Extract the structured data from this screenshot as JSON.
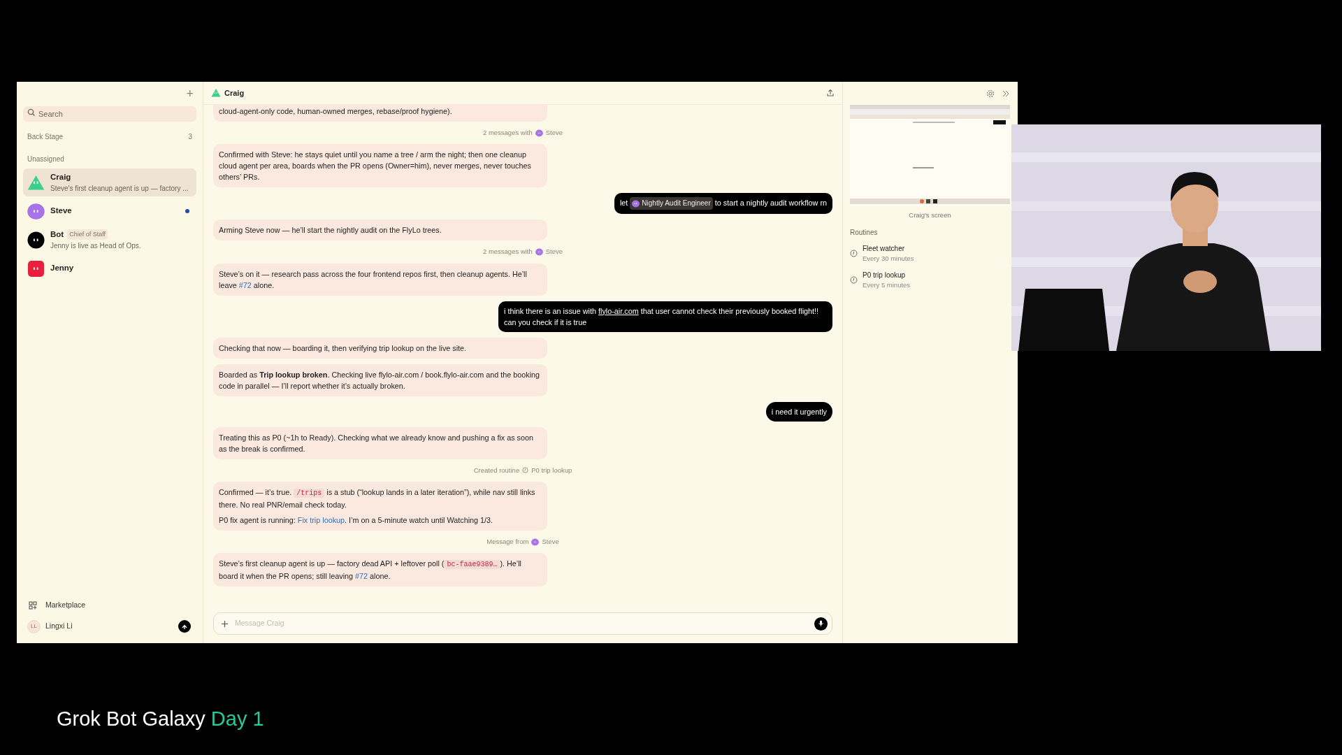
{
  "sidebar": {
    "new_button": "+",
    "search": {
      "placeholder": "Search"
    },
    "sections": [
      {
        "label": "Back Stage",
        "count": "3"
      }
    ],
    "group_label": "Unassigned",
    "contacts": [
      {
        "name": "Craig",
        "kind": "triangle",
        "color": "#3ecf8e",
        "preview": "Steve's first cleanup agent is up — factory ...",
        "selected": true,
        "unread": false
      },
      {
        "name": "Steve",
        "kind": "blob",
        "color": "#a872e8",
        "selected": false,
        "unread": true
      },
      {
        "name": "Bot",
        "kind": "circle",
        "color": "#000000",
        "badge": "Chief of Staff",
        "preview": "Jenny is live as Head of Ops.",
        "selected": false,
        "unread": false
      },
      {
        "name": "Jenny",
        "kind": "square",
        "color": "#e8203e",
        "selected": false,
        "unread": false
      }
    ],
    "footer": {
      "marketplace": "Marketplace",
      "user_initials": "LL",
      "user_name": "Lingxi Li"
    }
  },
  "chat": {
    "title": "Craig",
    "messages": [
      {
        "kind": "bot",
        "cut": true,
        "paragraphs": [
          [
            {
              "kind": "text",
              "text": "cloud-agent-only code, human-owned merges, rebase/proof hygiene)."
            }
          ]
        ]
      },
      {
        "kind": "divider",
        "text": "2 messages with",
        "agent": "Steve"
      },
      {
        "kind": "bot",
        "cut": false,
        "paragraphs": [
          [
            {
              "kind": "text",
              "text": "Confirmed with Steve: he stays quiet until you name a tree / arm the night; then one cleanup cloud agent per area, boards when the PR opens (Owner=him), never merges, never touches others’ PRs."
            }
          ]
        ]
      },
      {
        "kind": "user",
        "paragraphs": [
          [
            {
              "kind": "text",
              "text": "let "
            },
            {
              "kind": "mention",
              "text": "Nightly Audit Engineer"
            },
            {
              "kind": "text",
              "text": " to start a nightly audit workflow rn"
            }
          ]
        ]
      },
      {
        "kind": "bot",
        "cut": false,
        "paragraphs": [
          [
            {
              "kind": "text",
              "text": "Arming Steve now — he’ll start the nightly audit on the FlyLo trees."
            }
          ]
        ]
      },
      {
        "kind": "divider",
        "text": "2 messages with",
        "agent": "Steve"
      },
      {
        "kind": "bot",
        "cut": false,
        "paragraphs": [
          [
            {
              "kind": "text",
              "text": "Steve’s on it — research pass across the four frontend repos first, then cleanup agents. He’ll leave "
            },
            {
              "kind": "link",
              "text": "#72"
            },
            {
              "kind": "text",
              "text": " alone."
            }
          ]
        ]
      },
      {
        "kind": "user",
        "paragraphs": [
          [
            {
              "kind": "text",
              "text": "i think there is an issue with "
            },
            {
              "kind": "underline",
              "text": "flylo-air.com"
            },
            {
              "kind": "text",
              "text": " that user cannot check their previously booked flight!! can you check if it is true"
            }
          ]
        ]
      },
      {
        "kind": "bot",
        "cut": false,
        "paragraphs": [
          [
            {
              "kind": "text",
              "text": "Checking that now — boarding it, then verifying trip lookup on the live site."
            }
          ]
        ]
      },
      {
        "kind": "bot",
        "cut": false,
        "paragraphs": [
          [
            {
              "kind": "text",
              "text": "Boarded as **Trip lookup broken**. Checking live flylo-air.com / book.flylo-air.com and the booking code in parallel — I’ll report whether it’s actually broken."
            }
          ]
        ]
      },
      {
        "kind": "user",
        "paragraphs": [
          [
            {
              "kind": "text",
              "text": "i need it urgently"
            }
          ]
        ]
      },
      {
        "kind": "bot",
        "cut": false,
        "paragraphs": [
          [
            {
              "kind": "text",
              "text": "Treating this as P0 (~1h to Ready). Checking what we already know and pushing a fix as soon as the break is confirmed."
            }
          ]
        ]
      },
      {
        "kind": "event",
        "text": "Created routine",
        "routine": "P0 trip lookup"
      },
      {
        "kind": "bot",
        "cut": false,
        "paragraphs": [
          [
            {
              "kind": "text",
              "text": "Confirmed — it’s true. "
            },
            {
              "kind": "code",
              "text": "/trips"
            },
            {
              "kind": "text",
              "text": " is a stub (“lookup lands in a later iteration”), while nav still links there. No real PNR/email check today."
            }
          ],
          [
            {
              "kind": "text",
              "text": "P0 fix agent is running: "
            },
            {
              "kind": "link",
              "text": "Fix trip lookup"
            },
            {
              "kind": "text",
              "text": ". I’m on a 5-minute watch until Watching 1/3."
            }
          ]
        ]
      },
      {
        "kind": "divider",
        "text": "Message from",
        "agent": "Steve"
      },
      {
        "kind": "bot",
        "cut": false,
        "paragraphs": [
          [
            {
              "kind": "text",
              "text": "Steve’s first cleanup agent is up — factory dead API + leftover poll ("
            },
            {
              "kind": "code",
              "text": "bc-faae9389…"
            },
            {
              "kind": "text",
              "text": "). He’ll board it when the PR opens; still leaving "
            },
            {
              "kind": "link",
              "text": "#72"
            },
            {
              "kind": "text",
              "text": " alone."
            }
          ]
        ]
      }
    ],
    "composer": {
      "placeholder": "Message Craig"
    }
  },
  "panel": {
    "screen_caption": "Craig's screen",
    "routines_label": "Routines",
    "routines": [
      {
        "name": "Fleet watcher",
        "schedule": "Every 30 minutes"
      },
      {
        "name": "P0 trip lookup",
        "schedule": "Every 5 minutes"
      }
    ]
  },
  "caption": {
    "text": "Grok Bot Galaxy",
    "highlight": "Day 1"
  }
}
